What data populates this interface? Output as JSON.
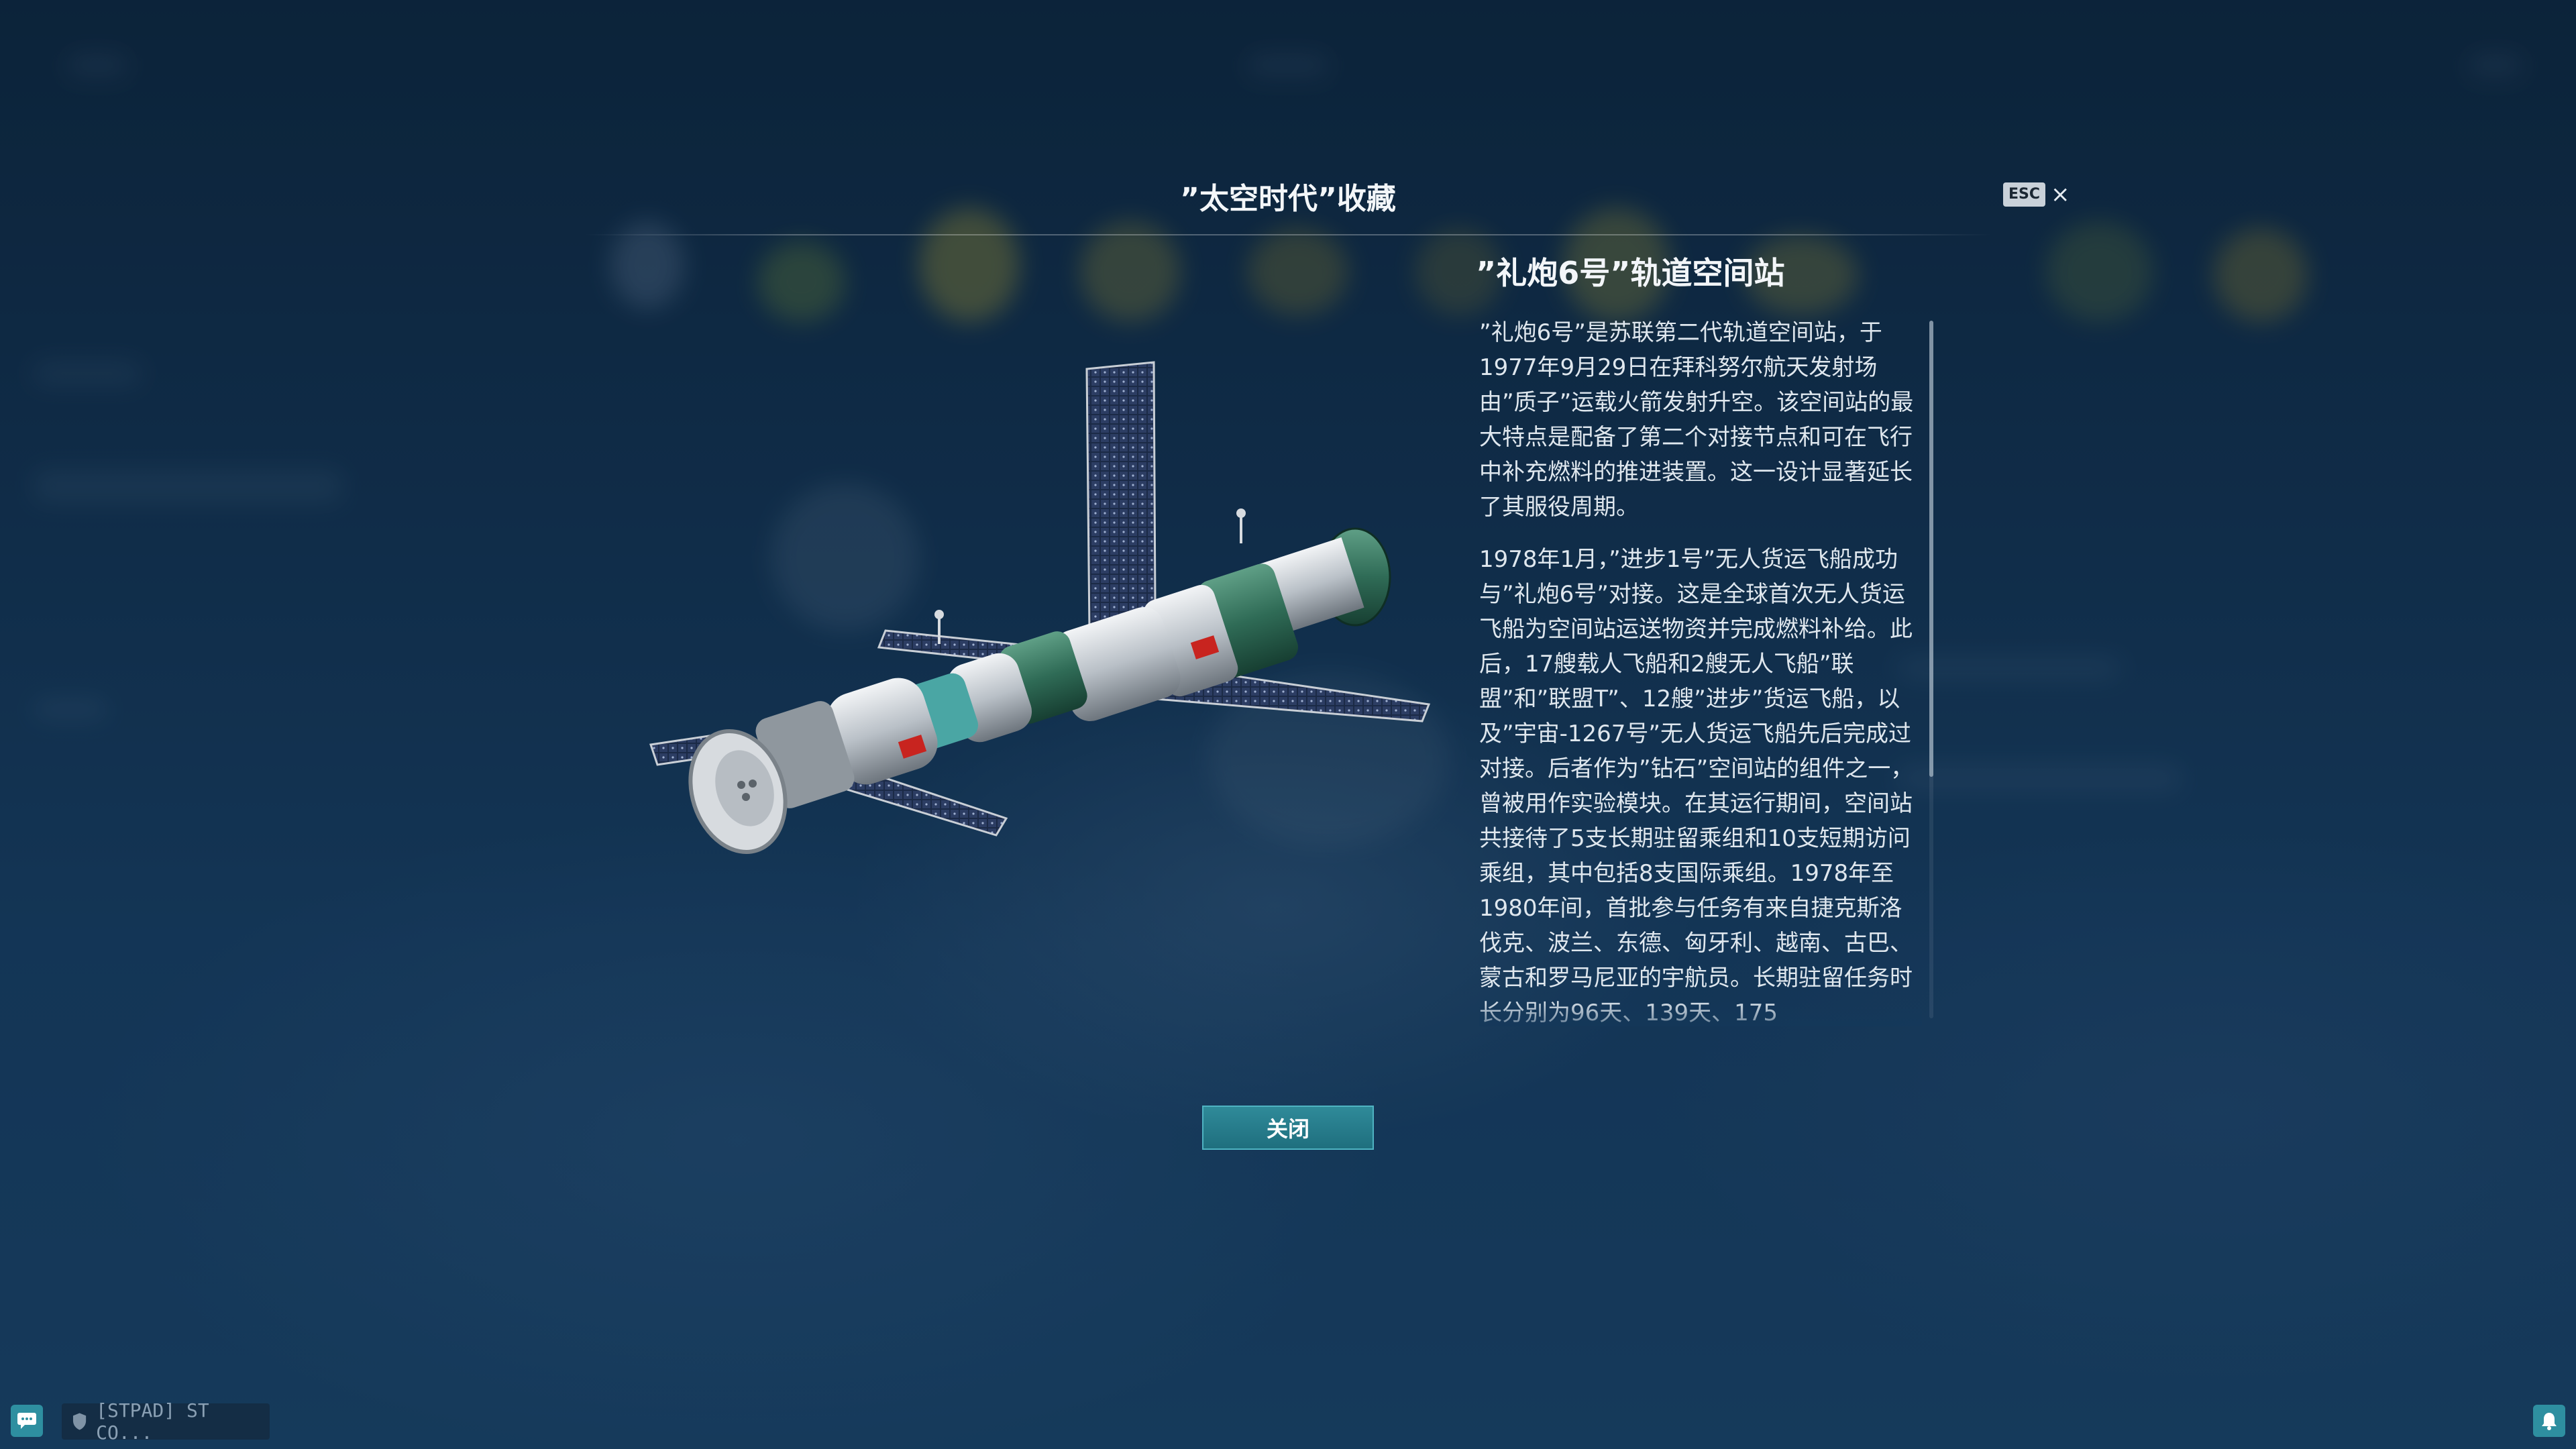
{
  "modal": {
    "title": "”太空时代”收藏",
    "esc_label": "ESC",
    "close_symbol": "×",
    "close_button_label": "关闭"
  },
  "item": {
    "title": "”礼炮6号”轨道空间站",
    "paragraphs": [
      "”礼炮6号”是苏联第二代轨道空间站，于1977年9月29日在拜科努尔航天发射场由”质子”运载火箭发射升空。该空间站的最大特点是配备了第二个对接节点和可在飞行中补充燃料的推进装置。这一设计显著延长了其服役周期。",
      "1978年1月，”进步1号”无人货运飞船成功与”礼炮6号”对接。这是全球首次无人货运飞船为空间站运送物资并完成燃料补给。此后，17艘载人飞船和2艘无人飞船”联盟”和”联盟T”、12艘”进步”货运飞船，以及”宇宙-1267号”无人货运飞船先后完成过对接。后者作为”钻石”空间站的组件之一，曾被用作实验模块。在其运行期间，空间站共接待了5支长期驻留乘组和10支短期访问乘组，其中包括8支国际乘组。1978年至1980年间，首批参与任务有来自捷克斯洛伐克、波兰、东德、匈牙利、越南、古巴、蒙古和罗马尼亚的宇航员。长期驻留任务时长分别为96天、139天、175"
    ],
    "scroll_position": 0.0
  },
  "bottom_bar": {
    "chat_icon": "chat-icon",
    "clan_icon": "shield-icon",
    "clan_text": "[STPAD] ST CO...",
    "bell_icon": "bell-icon"
  },
  "colors": {
    "accent": "#2e8fa0",
    "button_border": "#4fb3c2",
    "background": "#14385b"
  }
}
